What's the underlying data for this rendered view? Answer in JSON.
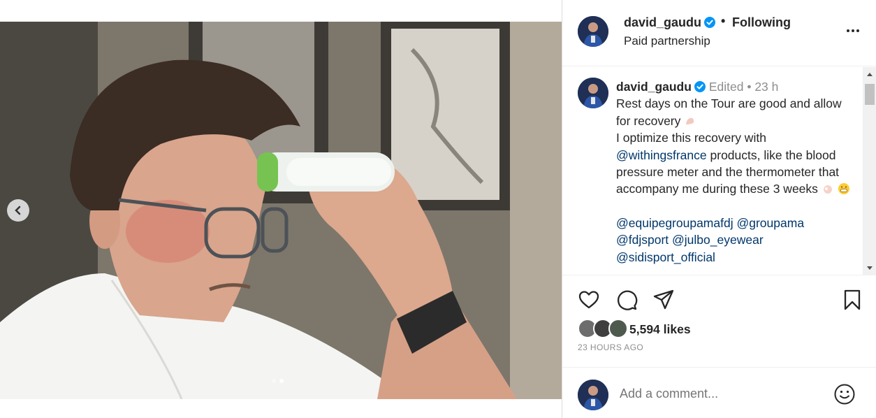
{
  "header": {
    "username": "david_gaudu",
    "separator": "•",
    "follow_label": "Following",
    "subtitle": "Paid partnership"
  },
  "caption": {
    "username": "david_gaudu",
    "edited": "Edited",
    "meta_sep": "•",
    "age": "23 h",
    "line1": "Rest days on the Tour are good and allow for recovery",
    "line2_pre": "I optimize this recovery with",
    "mention_brand": "@withingsfrance",
    "line2_post": "products, like the blood pressure meter and the thermometer that accompany me during these 3 weeks",
    "mentions": [
      "@equipegroupamafdj",
      "@groupama",
      "@fdjsport",
      "@julbo_eyewear",
      "@sidisport_official"
    ]
  },
  "actions": {
    "like_icon": "heart-icon",
    "comment_icon": "comment-icon",
    "share_icon": "paper-plane-icon",
    "save_icon": "bookmark-icon"
  },
  "likes": {
    "count_text": "5,594 likes"
  },
  "timestamp": "23 HOURS AGO",
  "comment": {
    "placeholder": "Add a comment..."
  },
  "carousel": {
    "total_slides": 2,
    "active_slide": 2
  },
  "colors": {
    "mention": "#00376b",
    "verified": "#0095f6",
    "meta": "#8e8e8e",
    "text": "#262626"
  }
}
